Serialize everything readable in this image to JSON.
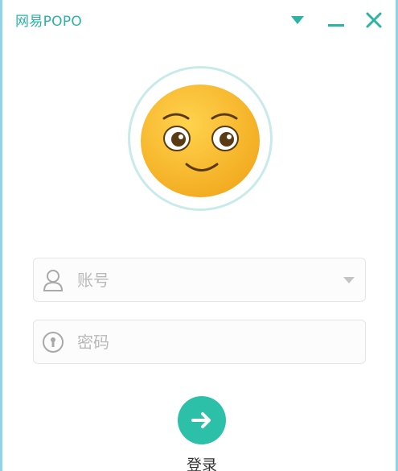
{
  "window": {
    "title": "网易POPO"
  },
  "titlebar": {
    "menu_icon": "triangle-down-icon",
    "minimize_icon": "minimize-icon",
    "close_icon": "close-icon"
  },
  "avatar": {
    "icon": "smiley-face-icon"
  },
  "login_form": {
    "account_placeholder": "账号",
    "account_value": "",
    "account_icon": "user-icon",
    "password_placeholder": "密码",
    "password_value": "",
    "password_icon": "lock-icon",
    "login_label": "登录",
    "login_icon": "arrow-right-icon"
  },
  "colors": {
    "accent": "#2cc0a8",
    "title": "#2bb3a4",
    "face": "#f5b82e"
  }
}
